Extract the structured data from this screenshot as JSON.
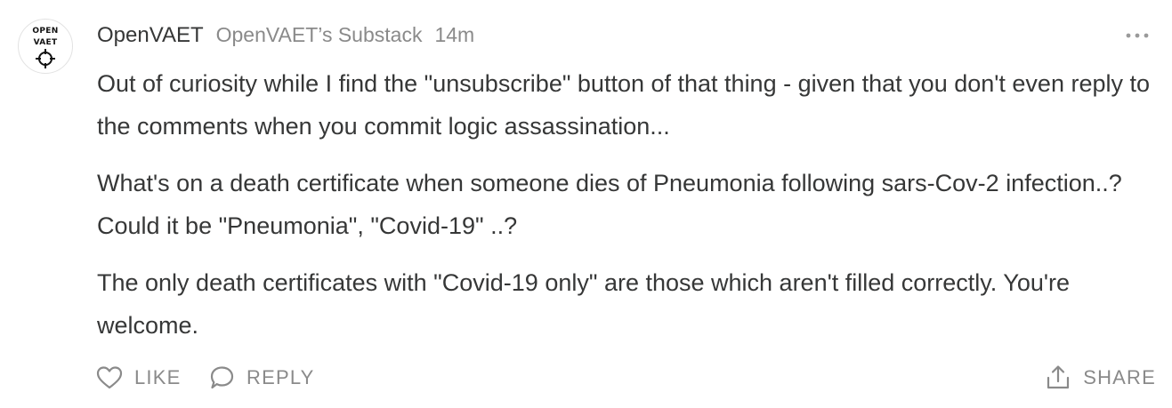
{
  "comment": {
    "avatar": {
      "line1": "OPEN",
      "line2": "VAET",
      "icon": "crosshair-icon"
    },
    "author": "OpenVAET",
    "publication": "OpenVAET’s Substack",
    "timestamp": "14m",
    "more_icon": "more-horizontal-icon",
    "paragraphs": [
      "Out of curiosity while I find the \"unsubscribe\" button of that thing - given that you don't even reply to the comments when you commit logic assassination...",
      "What's on a death certificate when someone dies of Pneumonia following sars-Cov-2 infection..? Could it be \"Pneumonia\", \"Covid-19\" ..?",
      "The only death certificates with \"Covid-19 only\" are those which aren't filled correctly. You're welcome."
    ],
    "actions": {
      "like": {
        "label": "LIKE",
        "icon": "heart-icon"
      },
      "reply": {
        "label": "REPLY",
        "icon": "speech-bubble-icon"
      },
      "share": {
        "label": "SHARE",
        "icon": "share-upload-icon"
      }
    }
  },
  "colors": {
    "text": "#363737",
    "muted": "#8a8a8a",
    "avatar_border": "#e2e2e2"
  }
}
